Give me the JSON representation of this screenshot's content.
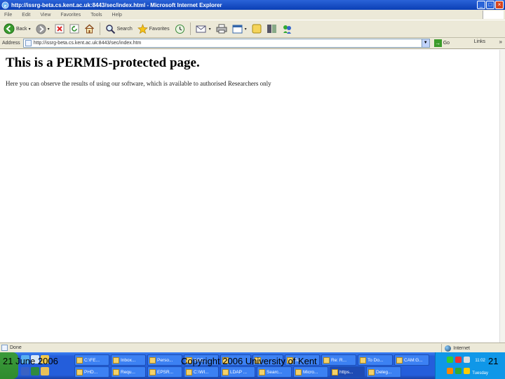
{
  "window": {
    "title": "http://issrg-beta.cs.kent.ac.uk:8443/sec/index.html - Microsoft Internet Explorer"
  },
  "menu": [
    "File",
    "Edit",
    "View",
    "Favorites",
    "Tools",
    "Help"
  ],
  "toolbar": {
    "back_label": "Back",
    "search_label": "Search",
    "favorites_label": "Favorites"
  },
  "address_bar": {
    "label": "Address",
    "url": "http://issrg-beta.cs.kent.ac.uk:8443/sec/index.htm",
    "go_label": "Go",
    "links_label": "Links"
  },
  "page": {
    "heading": "This is a PERMIS-protected page.",
    "text": "Here you can observe the results of using our software, which is available to authorised Researchers only"
  },
  "status_bar": {
    "status": "Done",
    "zone": "Internet"
  },
  "taskbar": {
    "tasks_row1": [
      "C:\\FE...",
      "Inbox...",
      "Perso...",
      "ACC...",
      "",
      "",
      "Te...",
      "Re: R...",
      "To Do...",
      "CAM:G..."
    ],
    "tasks_row2": [
      "PHD...",
      "Requ...",
      "EPSR...",
      "C:\\WI...",
      "LDAP ...",
      "Searc...",
      "Micro...",
      "https...",
      "Deleg..."
    ],
    "clock_time": "11:02",
    "clock_day": "Tuesday"
  },
  "footer": {
    "date": "21 June 2006",
    "copyright": "Copyright 2006 University of Kent",
    "page_number": "21"
  }
}
